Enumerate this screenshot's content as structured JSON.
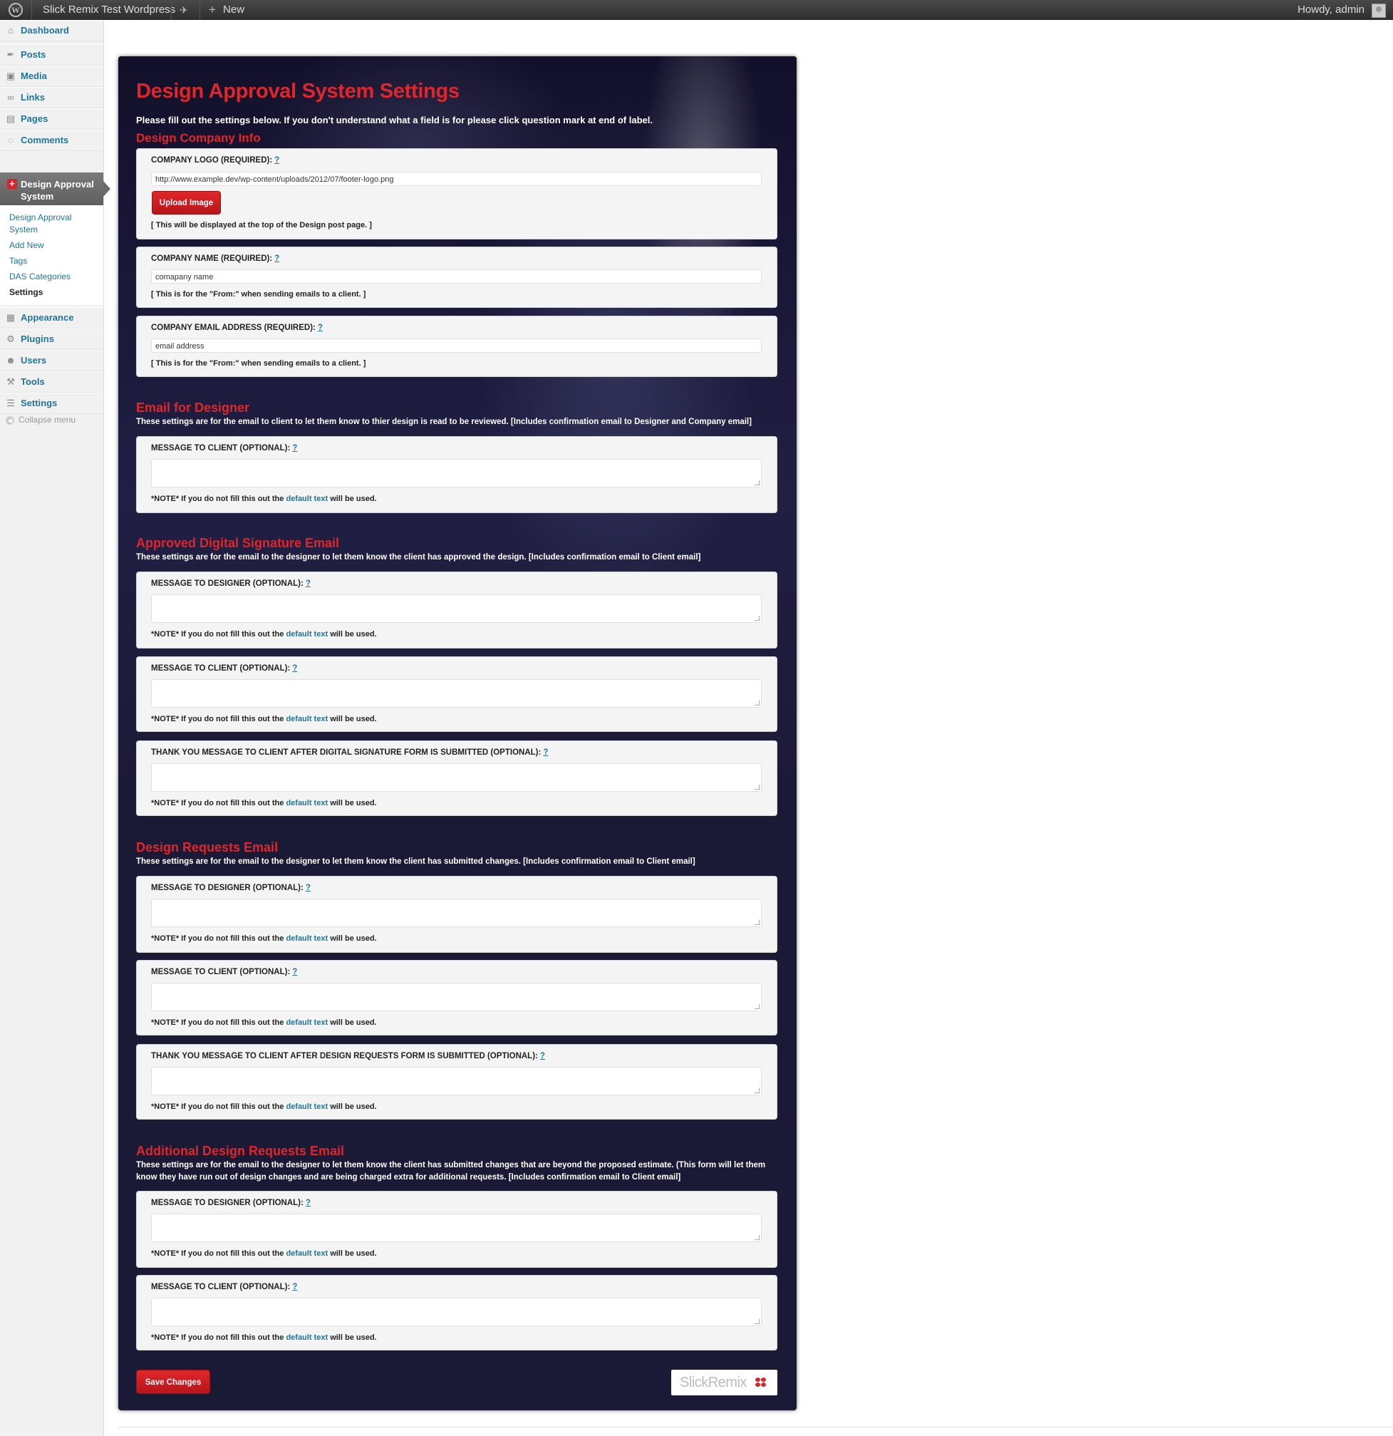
{
  "adminbar": {
    "site_name": "Slick Remix Test Wordpress",
    "new_label": "New",
    "greeting": "Howdy, admin"
  },
  "sidebar": {
    "items": [
      {
        "label": "Dashboard",
        "icon": "dashboard-icon"
      },
      {
        "label": "Posts",
        "icon": "pin-icon"
      },
      {
        "label": "Media",
        "icon": "media-icon"
      },
      {
        "label": "Links",
        "icon": "link-icon"
      },
      {
        "label": "Pages",
        "icon": "pages-icon"
      },
      {
        "label": "Comments",
        "icon": "comment-icon"
      }
    ],
    "current": {
      "label": "Design Approval System",
      "icon": "cross-icon"
    },
    "submenu": [
      "Design Approval System",
      "Add New",
      "Tags",
      "DAS Categories",
      "Settings"
    ],
    "items_after": [
      {
        "label": "Appearance",
        "icon": "appearance-icon"
      },
      {
        "label": "Plugins",
        "icon": "plug-icon"
      },
      {
        "label": "Users",
        "icon": "users-icon"
      },
      {
        "label": "Tools",
        "icon": "tools-icon"
      },
      {
        "label": "Settings",
        "icon": "settings-icon"
      }
    ],
    "collapse": "Collapse menu"
  },
  "page": {
    "title": "Design Approval System Settings",
    "intro": "Please fill out the settings below. If you don't understand what a field is for please click question mark at end of label.",
    "note_prefix": "*NOTE* If you do not fill this out the",
    "note_link": "default text",
    "note_suffix": "will be used.",
    "help_mark": "?"
  },
  "company": {
    "heading": "Design Company Info",
    "logo_label": "COMPANY LOGO (REQUIRED):",
    "logo_value": "http://www.example.dev/wp-content/uploads/2012/07/footer-logo.png",
    "upload_label": "Upload Image",
    "logo_help": "[ This will be displayed at the top of the Design post page. ]",
    "name_label": "COMPANY NAME (REQUIRED):",
    "name_value": "comapany name",
    "name_help": "[ This is for the \"From:\" when sending emails to a client. ]",
    "email_label": "COMPANY EMAIL ADDRESS (REQUIRED):",
    "email_value": "email address",
    "email_help": "[ This is for the \"From:\" when sending emails to a client. ]"
  },
  "designer_email": {
    "heading": "Email for Designer",
    "desc": "These settings are for the email to client to let them know to thier design is read to be reviewed. [Includes confirmation email to Designer and Company email]",
    "fields": [
      "MESSAGE TO CLIENT (OPTIONAL):"
    ]
  },
  "approved_email": {
    "heading": "Approved Digital Signature Email",
    "desc": "These settings are for the email to the designer to let them know the client has approved the design. [Includes confirmation email to Client email]",
    "fields": [
      "MESSAGE TO DESIGNER (OPTIONAL):",
      "MESSAGE TO CLIENT (OPTIONAL):",
      "THANK YOU MESSAGE TO CLIENT AFTER DIGITAL SIGNATURE FORM IS SUBMITTED (OPTIONAL):"
    ]
  },
  "requests_email": {
    "heading": "Design Requests Email",
    "desc": "These settings are for the email to the designer to let them know the client has submitted changes. [Includes confirmation email to Client email]",
    "fields": [
      "MESSAGE TO DESIGNER (OPTIONAL):",
      "MESSAGE TO CLIENT (OPTIONAL):",
      "THANK YOU MESSAGE TO CLIENT AFTER DESIGN REQUESTS FORM IS SUBMITTED (OPTIONAL):"
    ]
  },
  "additional_email": {
    "heading": "Additional Design Requests Email",
    "desc": "These settings are for the email to the designer to let them know the client has submitted changes that are beyond the proposed estimate. (This form will let them know they have run out of design changes and are being charged extra for additional requests. [Includes confirmation email to Client email]",
    "fields": [
      "MESSAGE TO DESIGNER (OPTIONAL):",
      "MESSAGE TO CLIENT (OPTIONAL):"
    ]
  },
  "footer": {
    "save_label": "Save Changes",
    "brand": "SlickRemix"
  },
  "colors": {
    "accent_red": "#e0262a",
    "link_blue": "#21759b",
    "panel_bg": "#1b1a36"
  }
}
